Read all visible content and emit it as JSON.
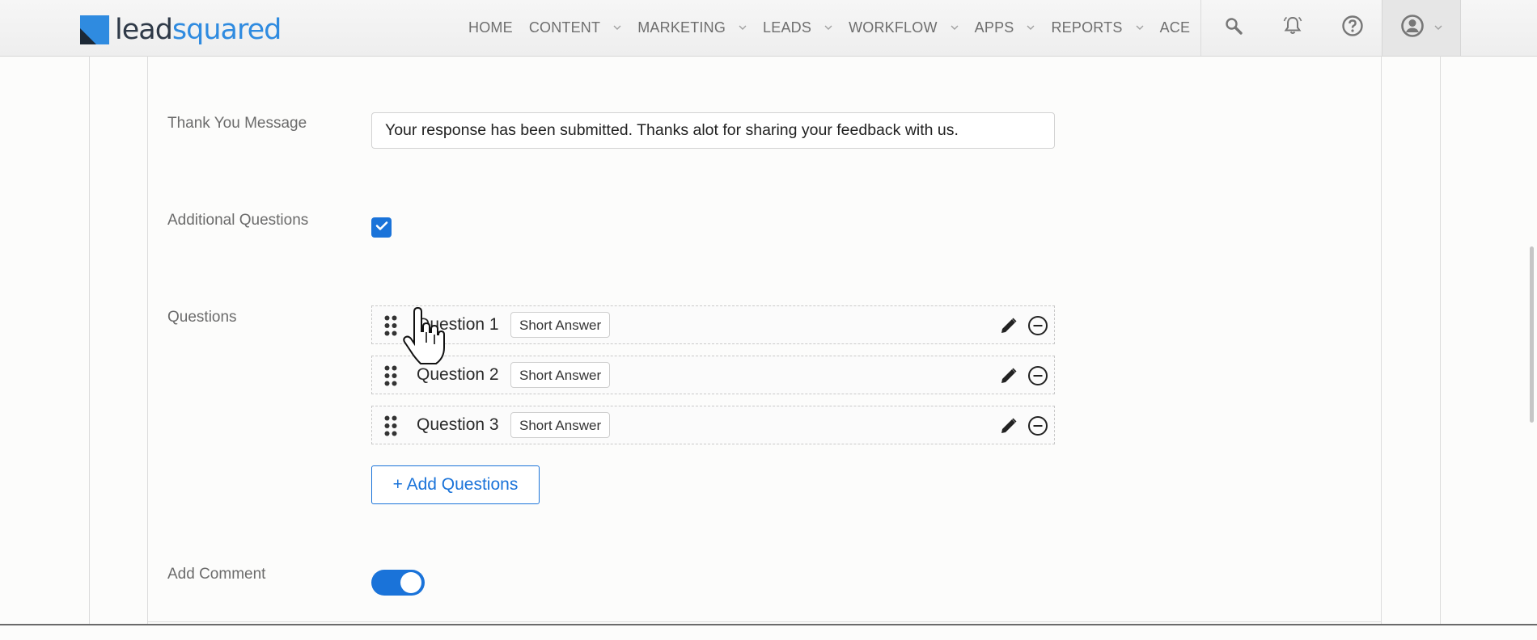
{
  "header": {
    "logo": {
      "part1": "lead",
      "part2": "squared"
    },
    "nav": [
      {
        "label": "HOME",
        "dropdown": false
      },
      {
        "label": "CONTENT",
        "dropdown": true
      },
      {
        "label": "MARKETING",
        "dropdown": true
      },
      {
        "label": "LEADS",
        "dropdown": true
      },
      {
        "label": "WORKFLOW",
        "dropdown": true
      },
      {
        "label": "APPS",
        "dropdown": true
      },
      {
        "label": "REPORTS",
        "dropdown": true
      },
      {
        "label": "ACE",
        "dropdown": false
      }
    ],
    "icons": [
      "search-icon",
      "bell-icon",
      "help-icon",
      "user-icon"
    ]
  },
  "form": {
    "thank_you": {
      "label": "Thank You Message",
      "value": "Your response has been submitted. Thanks alot for sharing your feedback with us."
    },
    "additional_questions": {
      "label": "Additional Questions",
      "checked": true
    },
    "questions": {
      "label": "Questions",
      "items": [
        {
          "title": "Question 1",
          "type": "Short Answer"
        },
        {
          "title": "Question 2",
          "type": "Short Answer"
        },
        {
          "title": "Question 3",
          "type": "Short Answer"
        }
      ],
      "add_label": "+ Add Questions"
    },
    "add_comment": {
      "label": "Add Comment",
      "enabled": true
    }
  },
  "colors": {
    "accent": "#1a73d9",
    "logo_blue": "#2f8be0",
    "logo_dark": "#2f3a48"
  }
}
